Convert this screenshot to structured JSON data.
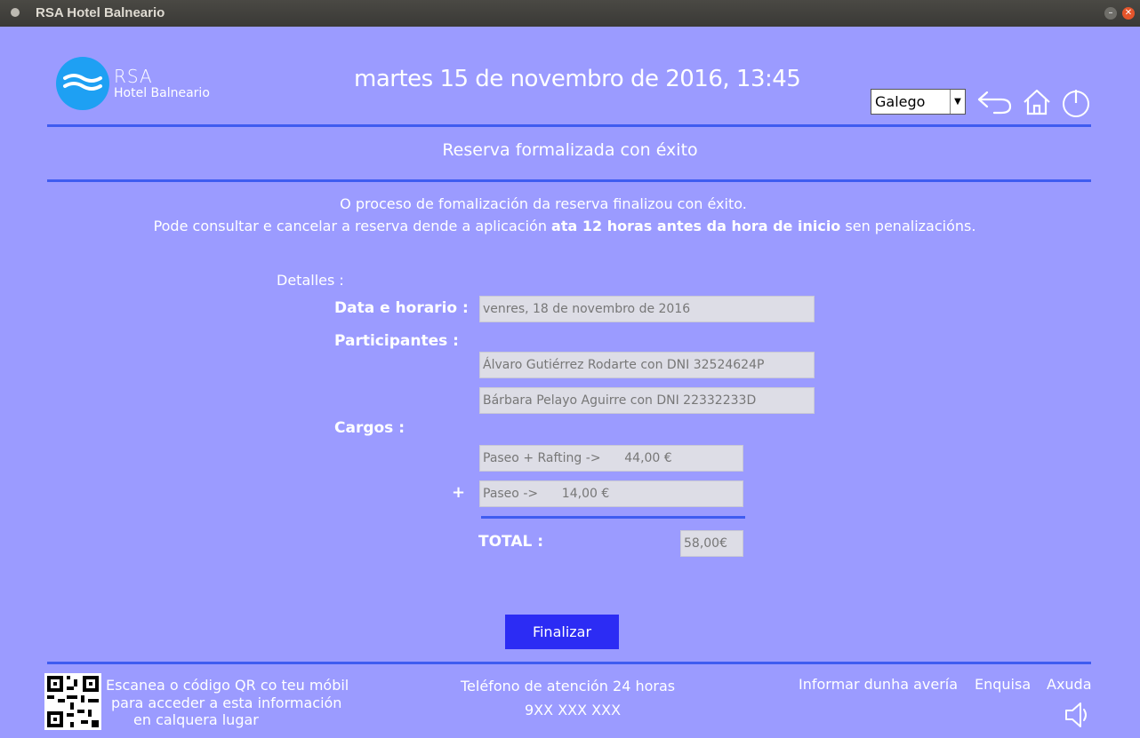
{
  "window": {
    "title": "RSA Hotel Balneario"
  },
  "header": {
    "logo_name": "RSA",
    "logo_subtitle": "Hotel Balneario",
    "datetime": "martes 15 de novembro de 2016, 13:45",
    "language_selected": "Galego"
  },
  "page": {
    "heading": "Reserva formalizada con éxito",
    "message_line1": "O proceso de fomalización da reserva finalizou con éxito.",
    "message_line2_a": "Pode consultar e cancelar a reserva dende a aplicación",
    "message_line2_bold": "ata 12 horas antes da hora de inicio",
    "message_line2_b": "sen penalizacións."
  },
  "details": {
    "title": "Detalles :",
    "date_label": "Data e horario :",
    "date_value": "venres, 18 de novembro de 2016",
    "participants_label": "Participantes :",
    "participants": [
      "Álvaro Gutiérrez Rodarte con DNI 32524624P",
      "Bárbara Pelayo Aguirre con DNI 22332233D"
    ],
    "charges_label": "Cargos :",
    "charges": [
      "Paseo + Rafting ->      44,00 €",
      "Paseo ->      14,00 €"
    ],
    "plus_sign": "+",
    "total_label": "TOTAL :",
    "total_value": "58,00€"
  },
  "actions": {
    "finish_label": "Finalizar"
  },
  "footer": {
    "qr_line1": "Escanea o código QR co teu móbil",
    "qr_line2": "para acceder a esta información",
    "qr_line3": "en calquera lugar",
    "phone_label": "Teléfono de atención 24 horas",
    "phone_number": "9XX XXX XXX",
    "link_fault": "Informar dunha avería",
    "link_survey": "Enquisa",
    "link_help": "Axuda"
  },
  "colors": {
    "background": "#9b9bff",
    "accent_rule": "#3f5cf0",
    "button": "#2c2cf4",
    "logo": "#1ea0f3"
  },
  "icons": [
    "back-arrow-icon",
    "home-icon",
    "power-icon",
    "speaker-icon",
    "qr-code-icon"
  ]
}
